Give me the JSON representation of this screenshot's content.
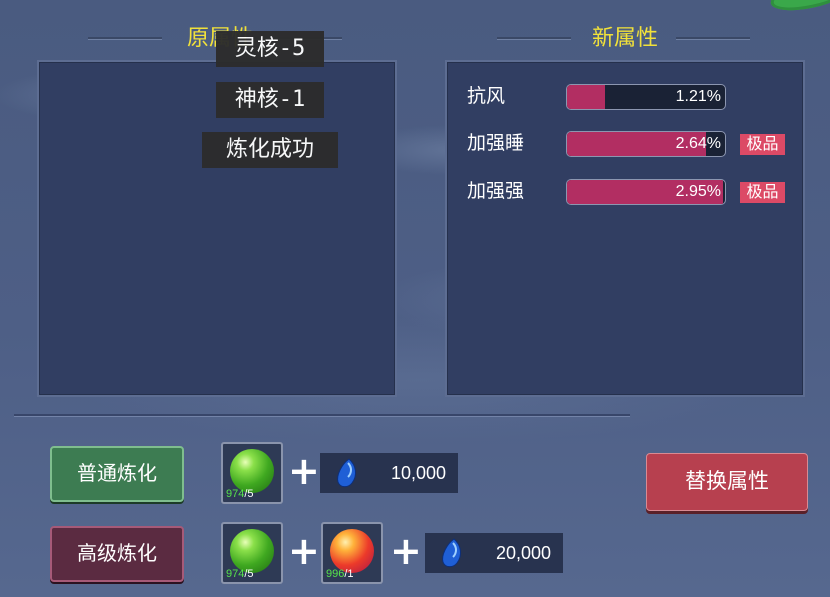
{
  "original_panel": {
    "title": "原属性"
  },
  "new_panel": {
    "title": "新属性",
    "attributes": [
      {
        "name": "抗风",
        "value_text": "1.21%",
        "fill_fraction": 0.24,
        "badge": ""
      },
      {
        "name": "加强睡",
        "value_text": "2.64%",
        "fill_fraction": 0.88,
        "badge": "极品"
      },
      {
        "name": "加强强",
        "value_text": "2.95%",
        "fill_fraction": 0.99,
        "badge": "极品"
      }
    ]
  },
  "toasts": [
    "灵核-5",
    "神核-1",
    "炼化成功"
  ],
  "normal_refine": {
    "button_label": "普通炼化",
    "slot1": {
      "icon": "green-orb-icon",
      "count_have": "974",
      "count_need": "5"
    },
    "cost": {
      "icon": "blue-gem-icon",
      "amount": "10,000"
    }
  },
  "advanced_refine": {
    "button_label": "高级炼化",
    "slot1": {
      "icon": "green-orb-icon",
      "count_have": "974",
      "count_need": "5"
    },
    "slot2": {
      "icon": "red-orb-icon",
      "count_have": "996",
      "count_need": "1"
    },
    "cost": {
      "icon": "blue-gem-icon",
      "amount": "20,000"
    }
  },
  "replace_button_label": "替换属性",
  "colors": {
    "title_yellow": "#f1e13a",
    "bar_fill": "#b22e62",
    "badge": "#dc4a66",
    "count_green": "#57e34b",
    "replace_button": "#b7404f"
  }
}
